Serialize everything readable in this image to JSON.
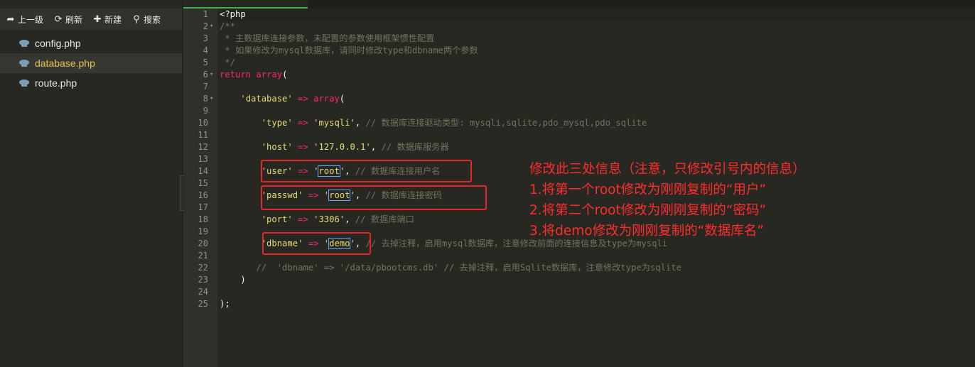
{
  "toolbar": {
    "up": {
      "icon": "arrow-up-icon",
      "label": "上一级"
    },
    "refresh": {
      "icon": "refresh-icon",
      "label": "刷新"
    },
    "new": {
      "icon": "plus-icon",
      "label": "新建"
    },
    "search": {
      "icon": "search-icon",
      "label": "搜索"
    }
  },
  "files": [
    {
      "name": "config.php",
      "active": false
    },
    {
      "name": "database.php",
      "active": true
    },
    {
      "name": "route.php",
      "active": false
    }
  ],
  "editor": {
    "lines": [
      {
        "n": "1"
      },
      {
        "n": "2",
        "fold": "▾"
      },
      {
        "n": "3"
      },
      {
        "n": "4"
      },
      {
        "n": "5"
      },
      {
        "n": "6",
        "fold": "▾"
      },
      {
        "n": "7"
      },
      {
        "n": "8",
        "fold": "▾"
      },
      {
        "n": "9"
      },
      {
        "n": "10"
      },
      {
        "n": "11"
      },
      {
        "n": "12"
      },
      {
        "n": "13"
      },
      {
        "n": "14"
      },
      {
        "n": "15"
      },
      {
        "n": "16"
      },
      {
        "n": "17"
      },
      {
        "n": "18"
      },
      {
        "n": "19"
      },
      {
        "n": "20"
      },
      {
        "n": "21"
      },
      {
        "n": "22"
      },
      {
        "n": "23"
      },
      {
        "n": "24"
      },
      {
        "n": "25"
      }
    ],
    "code": {
      "l1": "<?php",
      "l2": "/**",
      "l3": " * 主数据库连接参数，未配置的参数使用框架惯性配置",
      "l4": " * 如果修改为mysql数据库，请同时修改type和dbname两个参数",
      "l5": " */",
      "l6_kw": "return",
      "l6_fn": "array",
      "l6_p": "(",
      "l8_key": "'database'",
      "l8_op": "=>",
      "l8_fn": "array",
      "l8_p": "(",
      "l10_key": "'type'",
      "l10_op": "=>",
      "l10_val": "'mysqli'",
      "l10_c": "// 数据库连接驱动类型: mysqli,sqlite,pdo_mysql,pdo_sqlite",
      "l12_key": "'host'",
      "l12_op": "=>",
      "l12_val": "'127.0.0.1'",
      "l12_c": "// 数据库服务器",
      "l14_key": "'user'",
      "l14_op": "=>",
      "l14_q1": "'",
      "l14_val": "root",
      "l14_q2": "'",
      "l14_c": "// 数据库连接用户名",
      "l16_key": "'passwd'",
      "l16_op": "=>",
      "l16_q1": "'",
      "l16_val": "root",
      "l16_q2": "'",
      "l16_c": "// 数据库连接密码",
      "l18_key": "'port'",
      "l18_op": "=>",
      "l18_val": "'3306'",
      "l18_c": "// 数据库端口",
      "l20_key": "'dbname'",
      "l20_op": "=>",
      "l20_q1": "'",
      "l20_val": "demo",
      "l20_q2": "'",
      "l20_c": "// 去掉注释，启用mysql数据库，注意修改前面的连接信息及type为mysqli",
      "l22_c": "//  'dbname' => '/data/pbootcms.db' // 去掉注释，启用Sqlite数据库，注意修改type为sqlite",
      "l23": ")",
      "l25": ");"
    }
  },
  "annotations": [
    "修改此三处信息（注意，只修改引号内的信息）",
    "1.将第一个root修改为刚刚复制的“用户”",
    "2.将第二个root修改为刚刚复制的“密码”",
    "3.将demo修改为刚刚复制的“数据库名”"
  ],
  "colors": {
    "keyword": "#f92672",
    "string": "#e6db74",
    "comment": "#75715e",
    "annotation": "#ff2d2d",
    "active_file": "#e6c453"
  }
}
